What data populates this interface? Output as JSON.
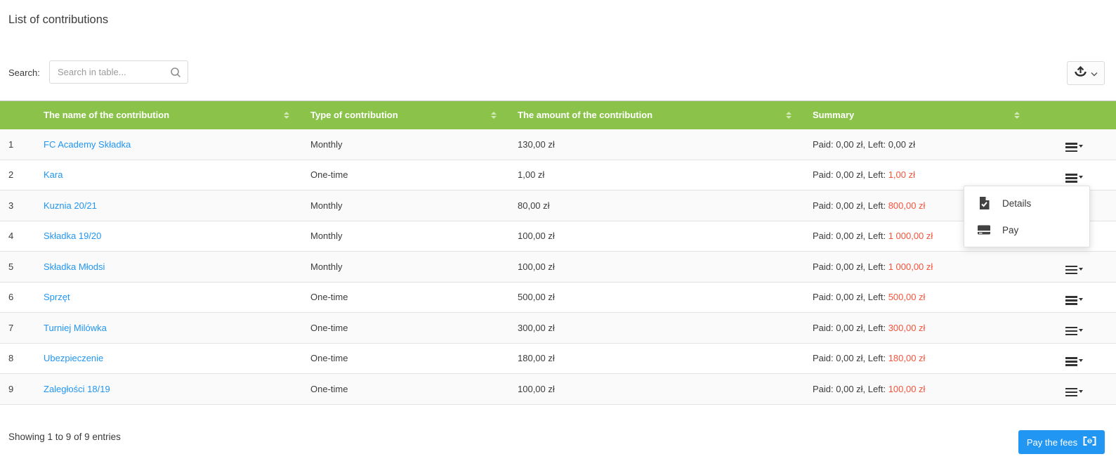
{
  "page": {
    "title": "List of contributions"
  },
  "search": {
    "label": "Search:",
    "placeholder": "Search in table..."
  },
  "toolbar": {
    "export_icon": "tray-arrow-up",
    "export_chevron": "chevron-down"
  },
  "table": {
    "columns": [
      {
        "label": "",
        "sortable": false
      },
      {
        "label": "The name of the contribution",
        "sortable": true
      },
      {
        "label": "Type of contribution",
        "sortable": true
      },
      {
        "label": "The amount of the contribution",
        "sortable": true
      },
      {
        "label": "Summary",
        "sortable": true
      },
      {
        "label": "",
        "sortable": false
      }
    ],
    "rows": [
      {
        "num": "1",
        "name": "FC Academy Składka",
        "type": "Monthly",
        "amount": "130,00 zł",
        "summary": {
          "prefix": "Paid: 0,00 zł, Left: ",
          "left": "0,00 zł",
          "highlight": false
        }
      },
      {
        "num": "2",
        "name": "Kara",
        "type": "One-time",
        "amount": "1,00 zł",
        "summary": {
          "prefix": "Paid: 0,00 zł, Left: ",
          "left": "1,00 zł",
          "highlight": true
        }
      },
      {
        "num": "3",
        "name": "Kuznia 20/21",
        "type": "Monthly",
        "amount": "80,00 zł",
        "summary": {
          "prefix": "Paid: 0,00 zł, Left: ",
          "left": "800,00 zł",
          "highlight": true
        }
      },
      {
        "num": "4",
        "name": "Składka 19/20",
        "type": "Monthly",
        "amount": "100,00 zł",
        "summary": {
          "prefix": "Paid: 0,00 zł, Left: ",
          "left": "1 000,00 zł",
          "highlight": true
        }
      },
      {
        "num": "5",
        "name": "Składka Młodsi",
        "type": "Monthly",
        "amount": "100,00 zł",
        "summary": {
          "prefix": "Paid: 0,00 zł, Left: ",
          "left": "1 000,00 zł",
          "highlight": true
        }
      },
      {
        "num": "6",
        "name": "Sprzęt",
        "type": "One-time",
        "amount": "500,00 zł",
        "summary": {
          "prefix": "Paid: 0,00 zł, Left: ",
          "left": "500,00 zł",
          "highlight": true
        }
      },
      {
        "num": "7",
        "name": "Turniej Milówka",
        "type": "One-time",
        "amount": "300,00 zł",
        "summary": {
          "prefix": "Paid: 0,00 zł, Left: ",
          "left": "300,00 zł",
          "highlight": true
        }
      },
      {
        "num": "8",
        "name": "Ubezpieczenie",
        "type": "One-time",
        "amount": "180,00 zł",
        "summary": {
          "prefix": "Paid: 0,00 zł, Left: ",
          "left": "180,00 zł",
          "highlight": true
        }
      },
      {
        "num": "9",
        "name": "Zaległości 18/19",
        "type": "One-time",
        "amount": "100,00 zł",
        "summary": {
          "prefix": "Paid: 0,00 zł, Left: ",
          "left": "100,00 zł",
          "highlight": true
        }
      }
    ]
  },
  "dropdown": {
    "items": [
      {
        "label": "Details",
        "icon": "document-check"
      },
      {
        "label": "Pay",
        "icon": "credit-card"
      }
    ]
  },
  "footer": {
    "showing": "Showing 1 to 9 of 9 entries",
    "pay_button": "Pay the fees",
    "pay_icon": "banknote"
  },
  "colors": {
    "header_green": "#8bc34a",
    "link_blue": "#2196f3",
    "left_red": "#f4543c",
    "button_blue": "#2196f3"
  }
}
